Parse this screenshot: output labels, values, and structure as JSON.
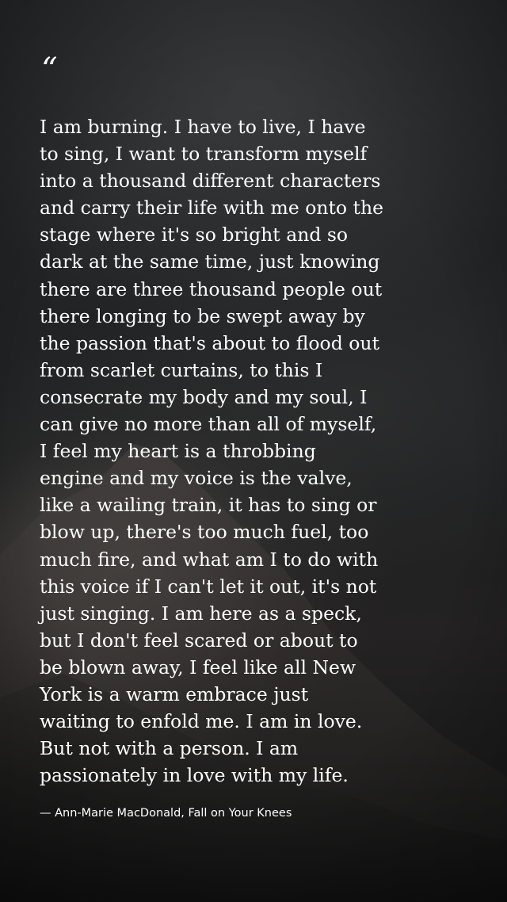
{
  "quote": {
    "mark": "“",
    "text": "I am burning. I have to live, I have\nto sing, I want to transform myself\ninto a thousand different characters\nand carry their life with me onto the\nstage where it's so bright and so\ndark at the same time, just knowing\nthere are three thousand people out\nthere longing to be swept away by\nthe passion that's about to flood out\nfrom scarlet curtains, to this I\nconsecrate my body and my soul, I\ncan give no more than all of myself,\nI feel my heart is a throbbing\nengine and my voice is the valve,\nlike a wailing train, it has to sing or\nblow up, there's too much fuel, too\nmuch fire, and what am I to do with\nthis voice if I can't let it out, it's not\njust singing. I am here as a speck,\nbut I don't feel scared or about to\nbe blown away, I feel like all New\nYork is a warm embrace just\nwaiting to enfold me. I am in love.\nBut not with a person. I am\npassionately in love with my life.",
    "attribution": "— Ann-Marie MacDonald, Fall on Your Knees"
  },
  "colors": {
    "text": "#ffffff",
    "background": "#1e1f20"
  }
}
